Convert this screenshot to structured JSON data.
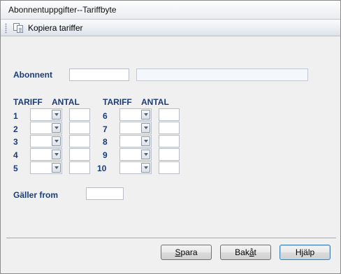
{
  "window": {
    "title": "Abonnentuppgifter--Tariffbyte"
  },
  "toolbar": {
    "copy_label": "Kopiera tariffer",
    "copy_icon": "copy-pages-icon"
  },
  "form": {
    "abonnent_label": "Abonnent",
    "abonnent_value": "",
    "abonnent_name": "",
    "col_tariff": "TARIFF",
    "col_antal": "ANTAL",
    "rows_left": [
      {
        "no": "1",
        "tariff": "",
        "antal": ""
      },
      {
        "no": "2",
        "tariff": "",
        "antal": ""
      },
      {
        "no": "3",
        "tariff": "",
        "antal": ""
      },
      {
        "no": "4",
        "tariff": "",
        "antal": ""
      },
      {
        "no": "5",
        "tariff": "",
        "antal": ""
      }
    ],
    "rows_right": [
      {
        "no": "6",
        "tariff": "",
        "antal": ""
      },
      {
        "no": "7",
        "tariff": "",
        "antal": ""
      },
      {
        "no": "8",
        "tariff": "",
        "antal": ""
      },
      {
        "no": "9",
        "tariff": "",
        "antal": ""
      },
      {
        "no": "10",
        "tariff": "",
        "antal": ""
      }
    ],
    "galler_label": "Gäller from",
    "galler_value": ""
  },
  "buttons": {
    "save": {
      "first": "S",
      "rest": "para"
    },
    "back": {
      "prefix": "Bak",
      "underlined": "å",
      "suffix": "t"
    },
    "help": {
      "prefix": "H",
      "underlined": "j",
      "suffix": "älp"
    }
  },
  "colors": {
    "label_blue": "#1a3c78",
    "window_bg": "#f0f0f0"
  }
}
